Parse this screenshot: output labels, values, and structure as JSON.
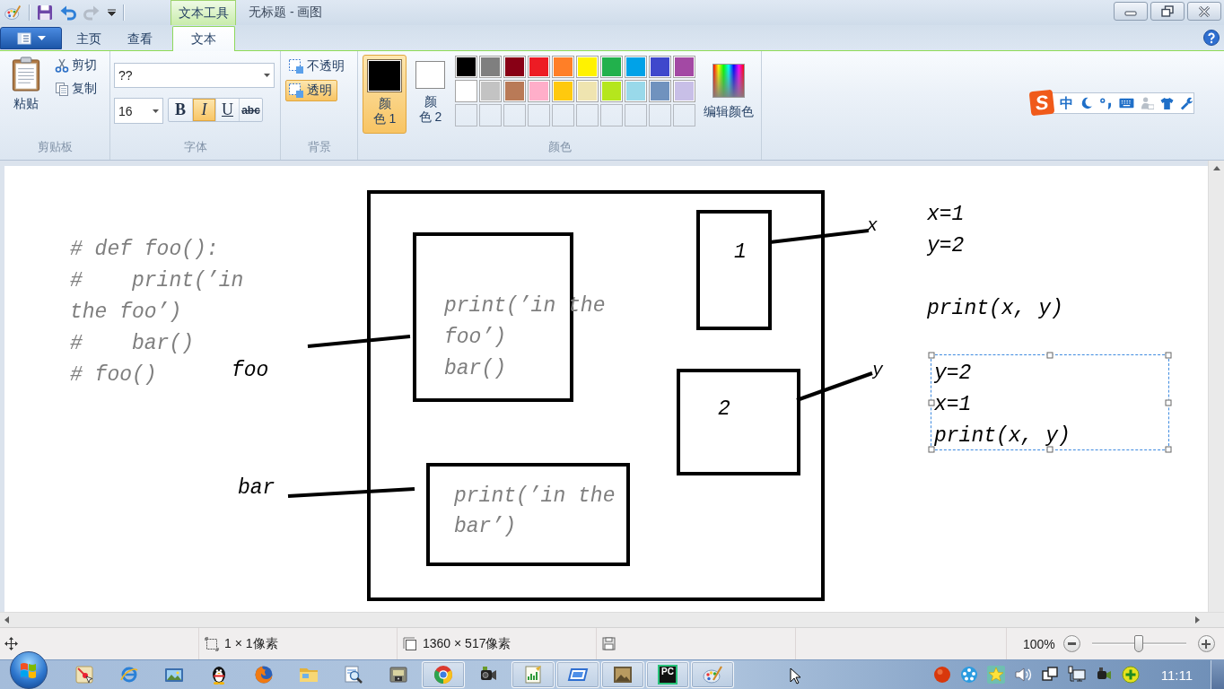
{
  "window": {
    "title": "无标题 - 画图",
    "context_tab": "文本工具"
  },
  "quick_access": [
    {
      "kind": "save",
      "disabled": false
    },
    {
      "kind": "undo",
      "disabled": false
    },
    {
      "kind": "redo",
      "disabled": true
    }
  ],
  "tabs": [
    {
      "label": "主页",
      "selected": false
    },
    {
      "label": "查看",
      "selected": false
    },
    {
      "label": "文本",
      "selected": true
    }
  ],
  "ribbon": {
    "clipboard": {
      "label": "剪贴板",
      "paste": "粘贴",
      "cut": "剪切",
      "copy": "复制"
    },
    "font": {
      "label": "字体",
      "family": "??",
      "size": "16",
      "styles": [
        {
          "kind": "bold",
          "text": "B",
          "selected": false
        },
        {
          "kind": "italic",
          "text": "I",
          "selected": true
        },
        {
          "kind": "underline",
          "text": "U",
          "selected": false
        },
        {
          "kind": "strikethrough",
          "text": "abc",
          "selected": false
        }
      ]
    },
    "background": {
      "label": "背景",
      "options": [
        {
          "label": "不透明",
          "selected": false
        },
        {
          "label": "透明",
          "selected": true
        }
      ]
    },
    "colors": {
      "label": "颜色",
      "current": [
        {
          "label": "颜色 1",
          "color": "#000000",
          "selected": true
        },
        {
          "label": "颜色 2",
          "color": "#ffffff",
          "selected": false
        }
      ],
      "palette": [
        {
          "color": "#000000"
        },
        {
          "color": "#7f7f7f"
        },
        {
          "color": "#880015"
        },
        {
          "color": "#ed1c24"
        },
        {
          "color": "#ff7f27"
        },
        {
          "color": "#fff200"
        },
        {
          "color": "#22b14c"
        },
        {
          "color": "#00a2e8"
        },
        {
          "color": "#3f48cc"
        },
        {
          "color": "#a349a4"
        },
        {
          "color": "#ffffff"
        },
        {
          "color": "#c3c3c3"
        },
        {
          "color": "#b97a57"
        },
        {
          "color": "#ffaec9"
        },
        {
          "color": "#ffc90e"
        },
        {
          "color": "#efe4b0"
        },
        {
          "color": "#b5e61d"
        },
        {
          "color": "#99d9ea"
        },
        {
          "color": "#7092be"
        },
        {
          "color": "#c8bfe7"
        }
      ],
      "custom": [
        {
          "filled": false
        },
        {
          "filled": false
        },
        {
          "filled": false
        },
        {
          "filled": false
        },
        {
          "filled": false
        },
        {
          "filled": false
        },
        {
          "filled": false
        },
        {
          "filled": false
        },
        {
          "filled": false
        },
        {
          "filled": false
        }
      ],
      "edit": "编辑颜色"
    }
  },
  "ime_toolbar": {
    "logo": "S",
    "mode": "中"
  },
  "canvas": {
    "shapes": [
      {
        "kind": "rectangle"
      },
      {
        "kind": "rectangle"
      },
      {
        "kind": "rectangle"
      },
      {
        "kind": "rectangle"
      },
      {
        "kind": "rectangle"
      },
      {
        "kind": "line"
      },
      {
        "kind": "line"
      },
      {
        "kind": "line"
      },
      {
        "kind": "line"
      }
    ],
    "texts": [
      {
        "text": "x",
        "color": "#000000",
        "selected": false
      },
      {
        "text": "x=1",
        "color": "#000000",
        "selected": false
      },
      {
        "text": "# def foo():",
        "color": "#7f7f7f",
        "selected": false
      },
      {
        "text": "1",
        "color": "#000000",
        "selected": false
      },
      {
        "text": "y=2",
        "color": "#000000",
        "selected": false
      },
      {
        "text": "#    print(’in",
        "color": "#7f7f7f",
        "selected": false
      },
      {
        "text": "the foo’)",
        "color": "#7f7f7f",
        "selected": false
      },
      {
        "text": "print(’in the",
        "color": "#7f7f7f",
        "selected": false
      },
      {
        "text": "print(x, y)",
        "color": "#000000",
        "selected": false
      },
      {
        "text": "#    bar()",
        "color": "#7f7f7f",
        "selected": false
      },
      {
        "text": "foo’)",
        "color": "#7f7f7f",
        "selected": false
      },
      {
        "text": "# foo()",
        "color": "#7f7f7f",
        "selected": false
      },
      {
        "text": "foo",
        "color": "#000000",
        "selected": false
      },
      {
        "text": "bar()",
        "color": "#7f7f7f",
        "selected": false
      },
      {
        "text": "y",
        "color": "#000000",
        "selected": false
      },
      {
        "text": "y=2",
        "color": "#000000",
        "selected": true
      },
      {
        "text": "2",
        "color": "#000000",
        "selected": false
      },
      {
        "text": "x=1",
        "color": "#000000",
        "selected": true
      },
      {
        "text": "print(x, y)",
        "color": "#000000",
        "selected": true
      },
      {
        "text": "bar",
        "color": "#000000",
        "selected": false
      },
      {
        "text": "print(’in the",
        "color": "#7f7f7f",
        "selected": false
      },
      {
        "text": "bar’)",
        "color": "#7f7f7f",
        "selected": false
      }
    ]
  },
  "status_bar": {
    "selection_size": "1 × 1像素",
    "image_size": "1360 × 517像素",
    "zoom": "100%",
    "zoom_slider": {
      "level": 0.5
    }
  },
  "taskbar": {
    "apps": [
      {
        "kind": "map",
        "running": false
      },
      {
        "kind": "browser",
        "running": false
      },
      {
        "kind": "viewer",
        "running": false
      },
      {
        "kind": "penguin",
        "running": false
      },
      {
        "kind": "globe",
        "running": false
      },
      {
        "kind": "folder",
        "running": false
      },
      {
        "kind": "search",
        "running": false
      },
      {
        "kind": "lock",
        "running": false
      },
      {
        "kind": "tricolor",
        "running": true
      },
      {
        "kind": "camcorder",
        "running": false
      },
      {
        "kind": "chart",
        "running": true
      },
      {
        "kind": "screen",
        "running": true
      },
      {
        "kind": "photo",
        "running": true
      },
      {
        "kind": "ide",
        "running": true,
        "text": "PC"
      },
      {
        "kind": "paint",
        "running": true
      }
    ],
    "clock": "11:11"
  }
}
